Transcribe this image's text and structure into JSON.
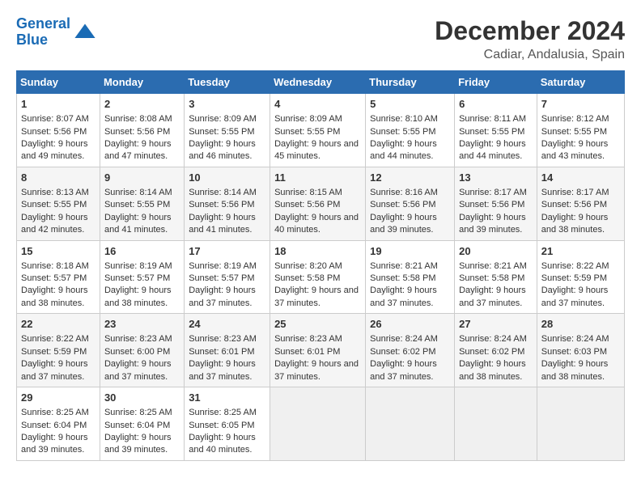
{
  "header": {
    "logo_line1": "General",
    "logo_line2": "Blue",
    "month": "December 2024",
    "location": "Cadiar, Andalusia, Spain"
  },
  "weekdays": [
    "Sunday",
    "Monday",
    "Tuesday",
    "Wednesday",
    "Thursday",
    "Friday",
    "Saturday"
  ],
  "weeks": [
    [
      {
        "day": "1",
        "rise": "8:07 AM",
        "set": "5:56 PM",
        "daylight": "9 hours and 49 minutes."
      },
      {
        "day": "2",
        "rise": "8:08 AM",
        "set": "5:56 PM",
        "daylight": "9 hours and 47 minutes."
      },
      {
        "day": "3",
        "rise": "8:09 AM",
        "set": "5:55 PM",
        "daylight": "9 hours and 46 minutes."
      },
      {
        "day": "4",
        "rise": "8:09 AM",
        "set": "5:55 PM",
        "daylight": "9 hours and 45 minutes."
      },
      {
        "day": "5",
        "rise": "8:10 AM",
        "set": "5:55 PM",
        "daylight": "9 hours and 44 minutes."
      },
      {
        "day": "6",
        "rise": "8:11 AM",
        "set": "5:55 PM",
        "daylight": "9 hours and 44 minutes."
      },
      {
        "day": "7",
        "rise": "8:12 AM",
        "set": "5:55 PM",
        "daylight": "9 hours and 43 minutes."
      }
    ],
    [
      {
        "day": "8",
        "rise": "8:13 AM",
        "set": "5:55 PM",
        "daylight": "9 hours and 42 minutes."
      },
      {
        "day": "9",
        "rise": "8:14 AM",
        "set": "5:55 PM",
        "daylight": "9 hours and 41 minutes."
      },
      {
        "day": "10",
        "rise": "8:14 AM",
        "set": "5:56 PM",
        "daylight": "9 hours and 41 minutes."
      },
      {
        "day": "11",
        "rise": "8:15 AM",
        "set": "5:56 PM",
        "daylight": "9 hours and 40 minutes."
      },
      {
        "day": "12",
        "rise": "8:16 AM",
        "set": "5:56 PM",
        "daylight": "9 hours and 39 minutes."
      },
      {
        "day": "13",
        "rise": "8:17 AM",
        "set": "5:56 PM",
        "daylight": "9 hours and 39 minutes."
      },
      {
        "day": "14",
        "rise": "8:17 AM",
        "set": "5:56 PM",
        "daylight": "9 hours and 38 minutes."
      }
    ],
    [
      {
        "day": "15",
        "rise": "8:18 AM",
        "set": "5:57 PM",
        "daylight": "9 hours and 38 minutes."
      },
      {
        "day": "16",
        "rise": "8:19 AM",
        "set": "5:57 PM",
        "daylight": "9 hours and 38 minutes."
      },
      {
        "day": "17",
        "rise": "8:19 AM",
        "set": "5:57 PM",
        "daylight": "9 hours and 37 minutes."
      },
      {
        "day": "18",
        "rise": "8:20 AM",
        "set": "5:58 PM",
        "daylight": "9 hours and 37 minutes."
      },
      {
        "day": "19",
        "rise": "8:21 AM",
        "set": "5:58 PM",
        "daylight": "9 hours and 37 minutes."
      },
      {
        "day": "20",
        "rise": "8:21 AM",
        "set": "5:58 PM",
        "daylight": "9 hours and 37 minutes."
      },
      {
        "day": "21",
        "rise": "8:22 AM",
        "set": "5:59 PM",
        "daylight": "9 hours and 37 minutes."
      }
    ],
    [
      {
        "day": "22",
        "rise": "8:22 AM",
        "set": "5:59 PM",
        "daylight": "9 hours and 37 minutes."
      },
      {
        "day": "23",
        "rise": "8:23 AM",
        "set": "6:00 PM",
        "daylight": "9 hours and 37 minutes."
      },
      {
        "day": "24",
        "rise": "8:23 AM",
        "set": "6:01 PM",
        "daylight": "9 hours and 37 minutes."
      },
      {
        "day": "25",
        "rise": "8:23 AM",
        "set": "6:01 PM",
        "daylight": "9 hours and 37 minutes."
      },
      {
        "day": "26",
        "rise": "8:24 AM",
        "set": "6:02 PM",
        "daylight": "9 hours and 37 minutes."
      },
      {
        "day": "27",
        "rise": "8:24 AM",
        "set": "6:02 PM",
        "daylight": "9 hours and 38 minutes."
      },
      {
        "day": "28",
        "rise": "8:24 AM",
        "set": "6:03 PM",
        "daylight": "9 hours and 38 minutes."
      }
    ],
    [
      {
        "day": "29",
        "rise": "8:25 AM",
        "set": "6:04 PM",
        "daylight": "9 hours and 39 minutes."
      },
      {
        "day": "30",
        "rise": "8:25 AM",
        "set": "6:04 PM",
        "daylight": "9 hours and 39 minutes."
      },
      {
        "day": "31",
        "rise": "8:25 AM",
        "set": "6:05 PM",
        "daylight": "9 hours and 40 minutes."
      },
      null,
      null,
      null,
      null
    ]
  ]
}
